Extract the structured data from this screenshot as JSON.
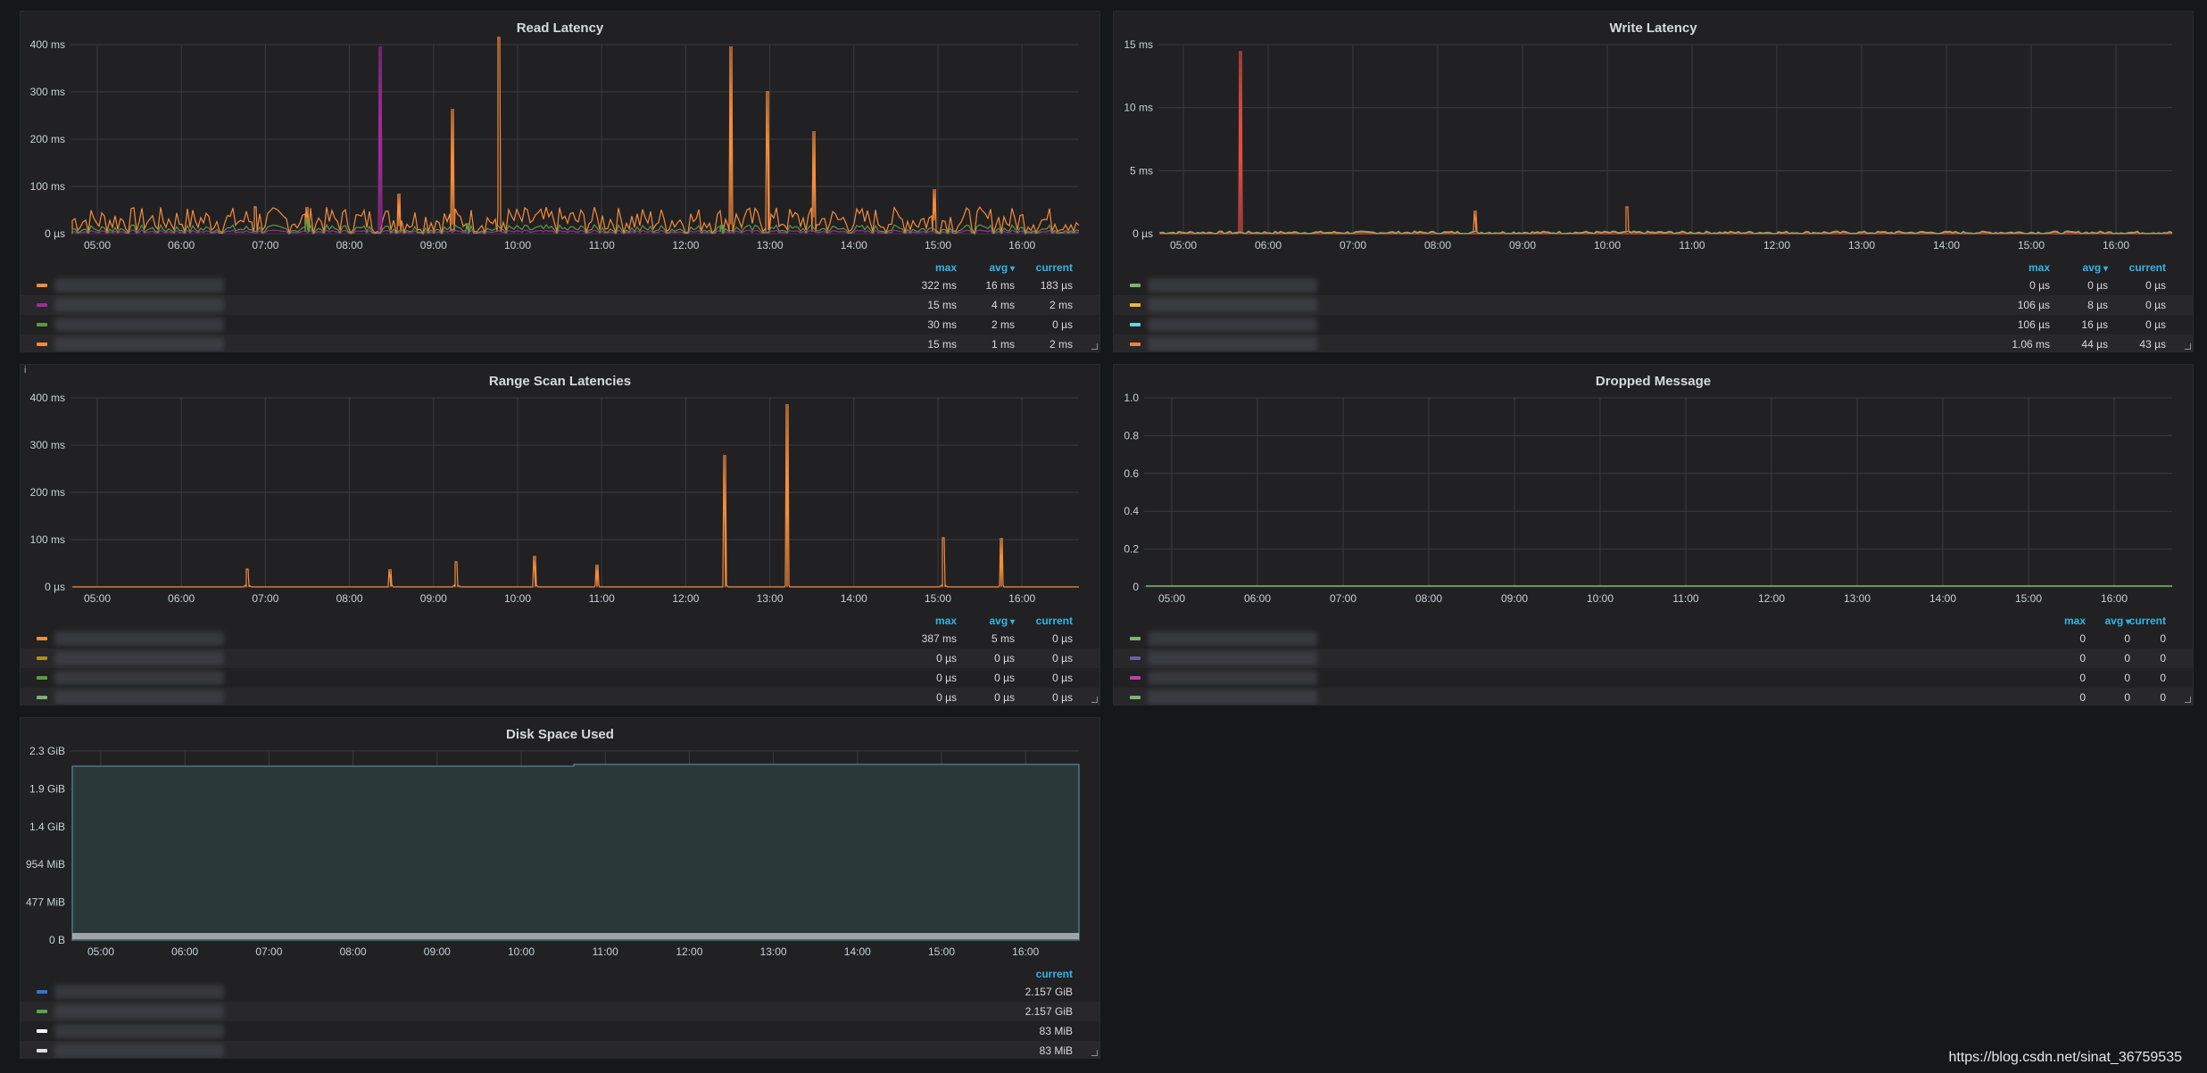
{
  "time_ticks": [
    "05:00",
    "06:00",
    "07:00",
    "08:00",
    "09:00",
    "10:00",
    "11:00",
    "12:00",
    "13:00",
    "14:00",
    "15:00",
    "16:00"
  ],
  "watermark": "https://blog.csdn.net/sinat_36759535",
  "panels": {
    "read_latency": {
      "title": "Read Latency",
      "y_ticks": [
        "400 ms",
        "300 ms",
        "200 ms",
        "100 ms",
        "0 µs"
      ],
      "legend_headers": [
        "max",
        "avg",
        "current"
      ],
      "legend_rows": [
        {
          "color": "#f58b3c",
          "max": "322 ms",
          "avg": "16 ms",
          "current": "183 µs"
        },
        {
          "color": "#a02a9c",
          "max": "15 ms",
          "avg": "4 ms",
          "current": "2 ms"
        },
        {
          "color": "#5a9b3e",
          "max": "30 ms",
          "avg": "2 ms",
          "current": "0 µs"
        },
        {
          "color": "#f58b3c",
          "max": "15 ms",
          "avg": "1 ms",
          "current": "2 ms"
        }
      ]
    },
    "write_latency": {
      "title": "Write Latency",
      "y_ticks": [
        "15 ms",
        "10 ms",
        "5 ms",
        "0 µs"
      ],
      "legend_headers": [
        "max",
        "avg",
        "current"
      ],
      "legend_rows": [
        {
          "color": "#7eb26d",
          "max": "0 µs",
          "avg": "0 µs",
          "current": "0 µs"
        },
        {
          "color": "#eab839",
          "max": "106 µs",
          "avg": "8 µs",
          "current": "0 µs"
        },
        {
          "color": "#6ed0e0",
          "max": "106 µs",
          "avg": "16 µs",
          "current": "0 µs"
        },
        {
          "color": "#ef843c",
          "max": "1.06 ms",
          "avg": "44 µs",
          "current": "43 µs"
        }
      ]
    },
    "range_scan": {
      "title": "Range Scan Latencies",
      "y_ticks": [
        "400 ms",
        "300 ms",
        "200 ms",
        "100 ms",
        "0 µs"
      ],
      "legend_headers": [
        "max",
        "avg",
        "current"
      ],
      "legend_rows": [
        {
          "color": "#f58b3c",
          "max": "387 ms",
          "avg": "5 ms",
          "current": "0 µs"
        },
        {
          "color": "#b08c1a",
          "max": "0 µs",
          "avg": "0 µs",
          "current": "0 µs"
        },
        {
          "color": "#5a9b3e",
          "max": "0 µs",
          "avg": "0 µs",
          "current": "0 µs"
        },
        {
          "color": "#7eb26d",
          "max": "0 µs",
          "avg": "0 µs",
          "current": "0 µs"
        }
      ]
    },
    "dropped_message": {
      "title": "Dropped Message",
      "y_ticks": [
        "1.0",
        "0.8",
        "0.6",
        "0.4",
        "0.2",
        "0"
      ],
      "legend_headers": [
        "max",
        "avg",
        "current"
      ],
      "legend_rows": [
        {
          "color": "#7eb26d",
          "max": "0",
          "avg": "0",
          "current": "0"
        },
        {
          "color": "#705da0",
          "max": "0",
          "avg": "0",
          "current": "0"
        },
        {
          "color": "#ba43a9",
          "max": "0",
          "avg": "0",
          "current": "0"
        },
        {
          "color": "#7eb26d",
          "max": "0",
          "avg": "0",
          "current": "0"
        }
      ]
    },
    "disk_space": {
      "title": "Disk Space Used",
      "y_ticks": [
        "2.3 GiB",
        "1.9 GiB",
        "1.4 GiB",
        "954 MiB",
        "477 MiB",
        "0 B"
      ],
      "legend_headers": [
        "current"
      ],
      "legend_rows": [
        {
          "color": "#3274d9",
          "current": "2.157 GiB"
        },
        {
          "color": "#56a64b",
          "current": "2.157 GiB"
        },
        {
          "color": "#ffffff",
          "current": "83 MiB"
        },
        {
          "color": "#e0e0e0",
          "current": "83 MiB"
        }
      ]
    }
  }
}
